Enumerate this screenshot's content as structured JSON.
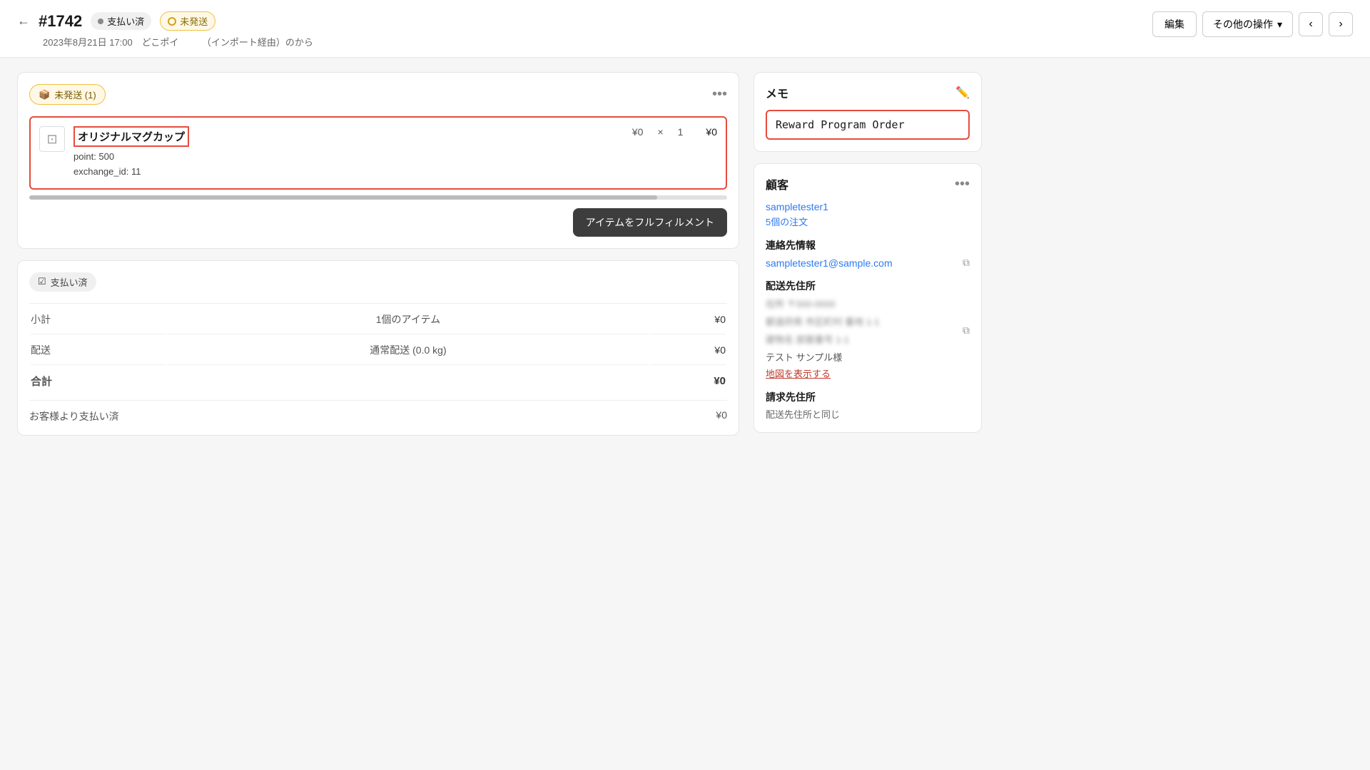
{
  "header": {
    "back_label": "←",
    "order_number": "#1742",
    "badge_paid": "支払い済",
    "badge_unfulfilled": "未発送",
    "subtitle": "2023年8月21日 17:00　どこポイ　　　（インポート経由）のから",
    "btn_edit": "編集",
    "btn_more": "その他の操作",
    "btn_prev": "‹",
    "btn_next": "›"
  },
  "fulfillment_card": {
    "badge": "未発送 (1)",
    "product_name": "オリジナルマグカップ",
    "product_meta_line1": "point: 500",
    "product_meta_line2": "exchange_id: 11",
    "price": "¥0",
    "multiplier": "×",
    "quantity": "1",
    "total": "¥0",
    "fulfill_btn": "アイテムをフルフィルメント"
  },
  "payment_card": {
    "badge": "支払い済",
    "rows": [
      {
        "label": "小計",
        "value": "1個のアイテム",
        "amount": "¥0"
      },
      {
        "label": "配送",
        "value": "通常配送 (0.0 kg)",
        "amount": "¥0"
      },
      {
        "label": "合計",
        "value": "",
        "amount": "¥0",
        "bold": true
      }
    ],
    "customer_paid_label": "お客様より支払い済",
    "customer_paid_amount": "¥0"
  },
  "memo_card": {
    "title": "メモ",
    "content": "Reward Program Order"
  },
  "customer_card": {
    "title": "顧客",
    "customer_name": "sampletester1",
    "orders_link": "5個の注文",
    "contact_title": "連絡先情報",
    "email": "sampletester1@sample.com",
    "shipping_title": "配送先住所",
    "address_line1": "住所 〒000-0000",
    "address_line2": "都道府県 市区町村 番地 1-1",
    "address_line3": "建物名 部屋番号 1-1",
    "address_name": "テスト サンプル様",
    "map_link": "地図を表示する",
    "billing_title": "請求先住所",
    "billing_same": "配送先住所と同じ"
  }
}
